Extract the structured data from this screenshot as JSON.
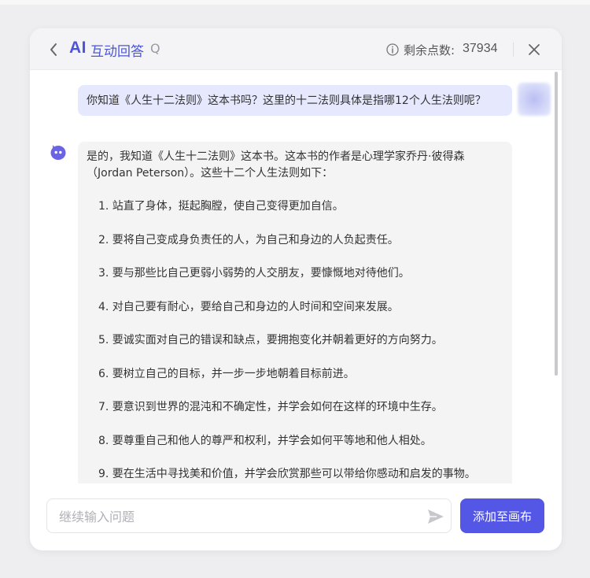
{
  "header": {
    "title_ai": "AI",
    "title_text": "互动回答",
    "title_suffix": "Q",
    "points_label": "剩余点数:",
    "points_value": "37934"
  },
  "messages": {
    "user": {
      "text": "你知道《人生十二法则》这本书吗？这里的十二法则具体是指哪12个人生法则呢？"
    },
    "bot": {
      "intro": "是的，我知道《人生十二法则》这本书。这本书的作者是心理学家乔丹·彼得森（Jordan Peterson）。这些十二个人生法则如下：",
      "rules": [
        "1. 站直了身体，挺起胸膛，使自己变得更加自信。",
        "2. 要将自己变成身负责任的人，为自己和身边的人负起责任。",
        "3. 要与那些比自己更弱小弱势的人交朋友，要慷慨地对待他们。",
        "4. 对自己要有耐心，要给自己和身边的人时间和空间来发展。",
        "5. 要诚实面对自己的错误和缺点，要拥抱变化并朝着更好的方向努力。",
        "6. 要树立自己的目标，并一步一步地朝着目标前进。",
        "7. 要意识到世界的混沌和不确定性，并学会如何在这样的环境中生存。",
        "8. 要尊重自己和他人的尊严和权利，并学会如何平等地和他人相处。",
        "9. 要在生活中寻找美和价值，并学会欣赏那些可以带给你感动和启发的事物。"
      ]
    }
  },
  "input": {
    "placeholder": "继续输入问题",
    "value": ""
  },
  "actions": {
    "add_to_canvas": "添加至画布"
  },
  "colors": {
    "accent": "#5457e6",
    "title": "#4a55d8",
    "user_bubble": "#e6e8fd",
    "bot_bubble": "#f4f4f5"
  },
  "icons": {
    "back": "chevron-left-icon",
    "info": "info-icon",
    "close": "close-icon",
    "bot_avatar": "bot-icon",
    "send": "send-icon"
  }
}
